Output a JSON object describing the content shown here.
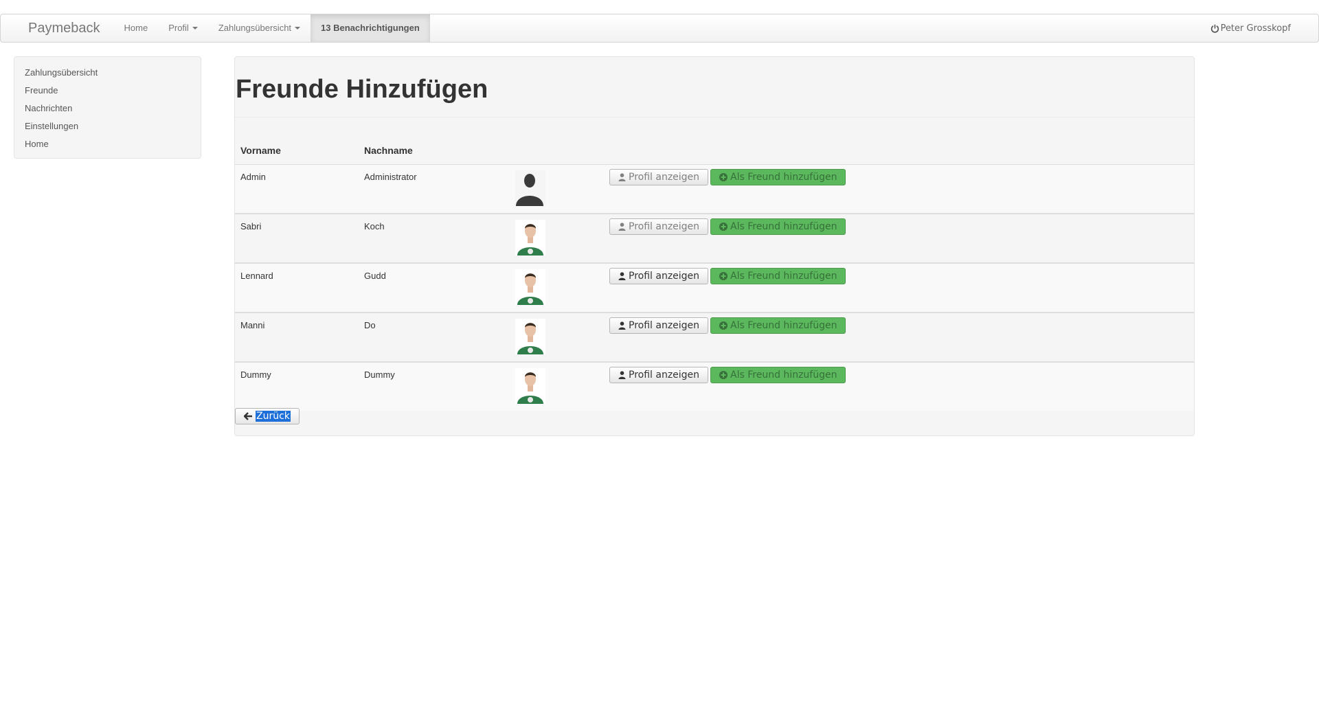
{
  "navbar": {
    "brand": "Paymeback",
    "items": [
      {
        "label": "Home",
        "dropdown": false,
        "active": false
      },
      {
        "label": "Profil",
        "dropdown": true,
        "active": false
      },
      {
        "label": "Zahlungsübersicht",
        "dropdown": true,
        "active": false
      },
      {
        "label": "13 Benachrichtigungen",
        "dropdown": false,
        "active": true
      }
    ],
    "user": "Peter Grosskopf",
    "user_icon": "power-icon"
  },
  "sidebar": {
    "items": [
      {
        "label": "Zahlungsübersicht"
      },
      {
        "label": "Freunde"
      },
      {
        "label": "Nachrichten"
      },
      {
        "label": "Einstellungen"
      },
      {
        "label": "Home"
      }
    ]
  },
  "main": {
    "title": "Freunde Hinzufügen",
    "columns": {
      "first": "Vorname",
      "last": "Nachname"
    },
    "rows": [
      {
        "first": "Admin",
        "last": "Administrator",
        "avatar": "silhouette-avatar",
        "profile_disabled": true
      },
      {
        "first": "Sabri",
        "last": "Koch",
        "avatar": "person-photo-avatar",
        "profile_disabled": true
      },
      {
        "first": "Lennard",
        "last": "Gudd",
        "avatar": "person-photo-avatar",
        "profile_disabled": false
      },
      {
        "first": "Manni",
        "last": "Do",
        "avatar": "person-photo-avatar",
        "profile_disabled": false
      },
      {
        "first": "Dummy",
        "last": "Dummy",
        "avatar": "person-photo-avatar",
        "profile_disabled": false
      }
    ],
    "profile_button": "Profil anzeigen",
    "add_button": "Als Freund hinzufügen",
    "back_button": "Zurück"
  },
  "colors": {
    "success": "#5cb85c",
    "selection": "#1e6fd9",
    "panel": "#f5f5f5"
  }
}
